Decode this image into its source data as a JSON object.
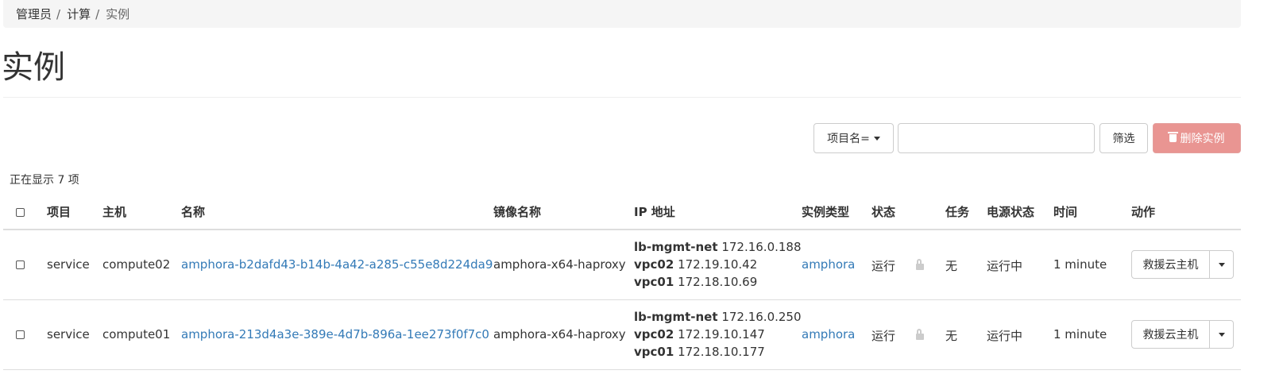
{
  "breadcrumb": {
    "items": [
      "管理员",
      "计算",
      "实例"
    ],
    "separator": "/"
  },
  "page": {
    "title": "实例"
  },
  "filter": {
    "select_label": "项目名=",
    "input_value": "",
    "filter_button": "筛选",
    "delete_button": "删除实例"
  },
  "count_text": "正在显示 7 项",
  "table": {
    "headers": [
      "项目",
      "主机",
      "名称",
      "镜像名称",
      "IP 地址",
      "实例类型",
      "状态",
      "任务",
      "电源状态",
      "时间",
      "动作"
    ],
    "rows": [
      {
        "project": "service",
        "host": "compute02",
        "name": "amphora-b2dafd43-b14b-4a42-a285-c55e8d224da9",
        "image": "amphora-x64-haproxy",
        "ips": [
          {
            "net": "lb-mgmt-net",
            "ip": "172.16.0.188"
          },
          {
            "net": "vpc02",
            "ip": "172.19.10.42"
          },
          {
            "net": "vpc01",
            "ip": "172.18.10.69"
          }
        ],
        "flavor": "amphora",
        "status": "运行",
        "task": "无",
        "power": "运行中",
        "time": "1 minute",
        "action": "救援云主机"
      },
      {
        "project": "service",
        "host": "compute01",
        "name": "amphora-213d4a3e-389e-4d7b-896a-1ee273f0f7c0",
        "image": "amphora-x64-haproxy",
        "ips": [
          {
            "net": "lb-mgmt-net",
            "ip": "172.16.0.250"
          },
          {
            "net": "vpc02",
            "ip": "172.19.10.147"
          },
          {
            "net": "vpc01",
            "ip": "172.18.10.177"
          }
        ],
        "flavor": "amphora",
        "status": "运行",
        "task": "无",
        "power": "运行中",
        "time": "1 minute",
        "action": "救援云主机"
      }
    ]
  },
  "icons": {
    "trash": "trash-icon",
    "lock": "unlock-icon",
    "caret": "caret-down-icon"
  },
  "colors": {
    "link": "#337ab7",
    "danger": "#e8908d",
    "breadcrumb_bg": "#f5f5f5"
  }
}
